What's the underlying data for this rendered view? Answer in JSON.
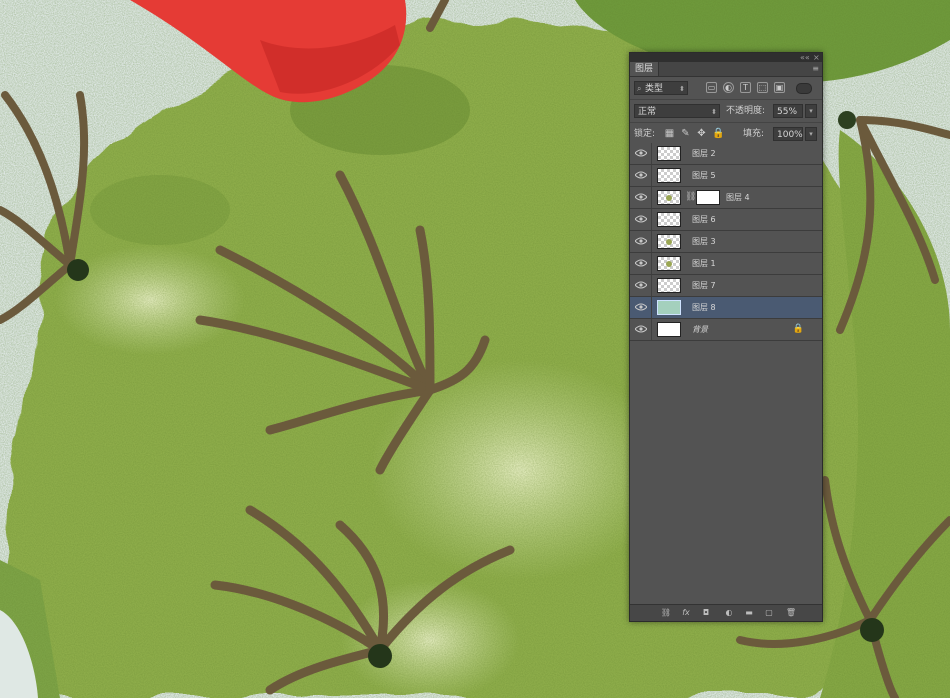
{
  "panel": {
    "collapse": "««",
    "close": "×",
    "tab_title": "图层",
    "tab_menu": "≡",
    "filter_type": "类型",
    "filter_icons": [
      "image-filter-icon",
      "adjustment-filter-icon",
      "text-filter-icon",
      "shape-filter-icon",
      "smart-object-filter-icon"
    ],
    "blend_mode": "正常",
    "opacity_label": "不透明度:",
    "opacity_value": "55%",
    "lock_label": "锁定:",
    "lock_icons": [
      "lock-transparent-icon",
      "lock-image-icon",
      "lock-position-icon",
      "lock-all-icon"
    ],
    "fill_label": "填充:",
    "fill_value": "100%"
  },
  "layers": [
    {
      "name": "图层 2",
      "thumb": "transparent",
      "selected": false
    },
    {
      "name": "图层 5",
      "thumb": "transparent",
      "selected": false
    },
    {
      "name": "图层 4",
      "thumb": "transparent-dot",
      "mask": true,
      "selected": false
    },
    {
      "name": "图层 6",
      "thumb": "transparent",
      "selected": false
    },
    {
      "name": "图层 3",
      "thumb": "transparent-dot",
      "selected": false
    },
    {
      "name": "图层 1",
      "thumb": "transparent-dot",
      "selected": false
    },
    {
      "name": "图层 7",
      "thumb": "transparent",
      "selected": false
    },
    {
      "name": "图层 8",
      "thumb": "green",
      "selected": true
    },
    {
      "name": "背景",
      "thumb": "white",
      "locked": true,
      "selected": false
    }
  ],
  "footer": {
    "link": "⛓",
    "fx": "fx",
    "mask": "◘",
    "adjust": "◐",
    "group": "▬",
    "new": "▢",
    "trash": "🗑"
  },
  "colors": {
    "cactus_green": "#8fae4b",
    "background_mint": "#dfe8e4",
    "flower_red": "#e53b35",
    "spine_brown": "#6b5a3c",
    "panel_gray": "#535353",
    "selected_row": "#4a5a72"
  }
}
